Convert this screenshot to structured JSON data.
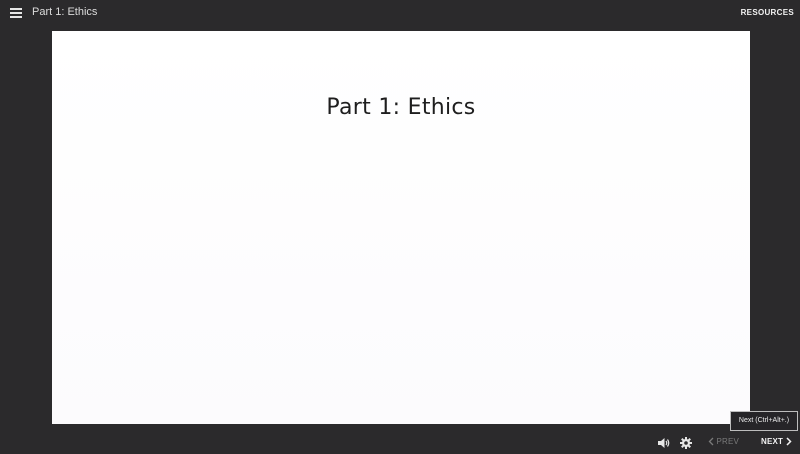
{
  "header": {
    "course_title": "Part 1: Ethics",
    "resources_label": "RESOURCES",
    "menu_icon": "hamburger-menu-icon"
  },
  "slide": {
    "title": "Part 1: Ethics"
  },
  "tooltip": {
    "text": "Next (Ctrl+Alt+.)"
  },
  "controls": {
    "volume_icon": "volume-icon",
    "settings_icon": "gear-icon",
    "prev_label": "PREV",
    "next_label": "NEXT"
  },
  "colors": {
    "background": "#2b2a2c",
    "slide": "#ffffff",
    "text_light": "#f2f2f2",
    "disabled": "#7a7a7a"
  }
}
